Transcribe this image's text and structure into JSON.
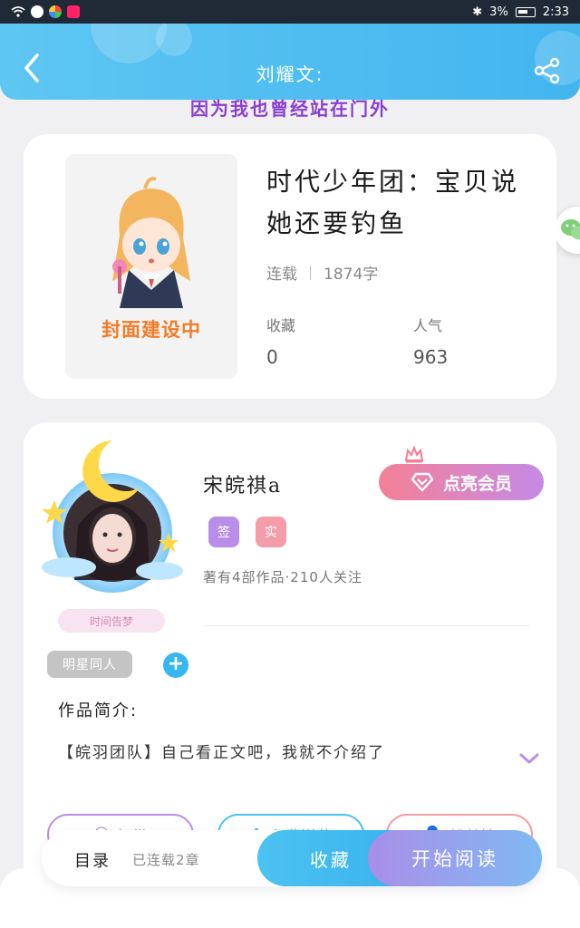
{
  "status_bar": {
    "time": "2:33",
    "battery": "3%"
  },
  "header": {
    "title": "刘耀文:",
    "subtitle": "因为我也曾经站在门外"
  },
  "book": {
    "cover_label": "封面建设中",
    "title": "时代少年团：宝贝说她还要钓鱼",
    "status": "连载",
    "word_count": "1874字",
    "stats": [
      {
        "label": "收藏",
        "value": "0"
      },
      {
        "label": "人气",
        "value": "963"
      }
    ]
  },
  "author": {
    "name": "宋皖祺a",
    "avatar_caption": "时间告梦",
    "vip_button": "点亮会员",
    "badges": [
      {
        "label": "签",
        "color": "#b88ee8"
      },
      {
        "label": "实",
        "color": "#f49ca8"
      }
    ],
    "summary": "著有4部作品·210人关注",
    "tag": "明星同人",
    "intro_label": "作品简介:",
    "intro_text": "【皖羽团队】自己看正文吧，我就不介绍了"
  },
  "actions": [
    {
      "label": "打赏",
      "color": "#b88ee8"
    },
    {
      "label": "免费送花",
      "color": "#4cc2f0"
    },
    {
      "label": "粉丝榜",
      "color": "#f49ca8"
    }
  ],
  "bottom_bar": {
    "catalog_label": "目录",
    "chapter_status": "已连载2章",
    "collect_label": "收藏",
    "read_label": "开始阅读"
  }
}
